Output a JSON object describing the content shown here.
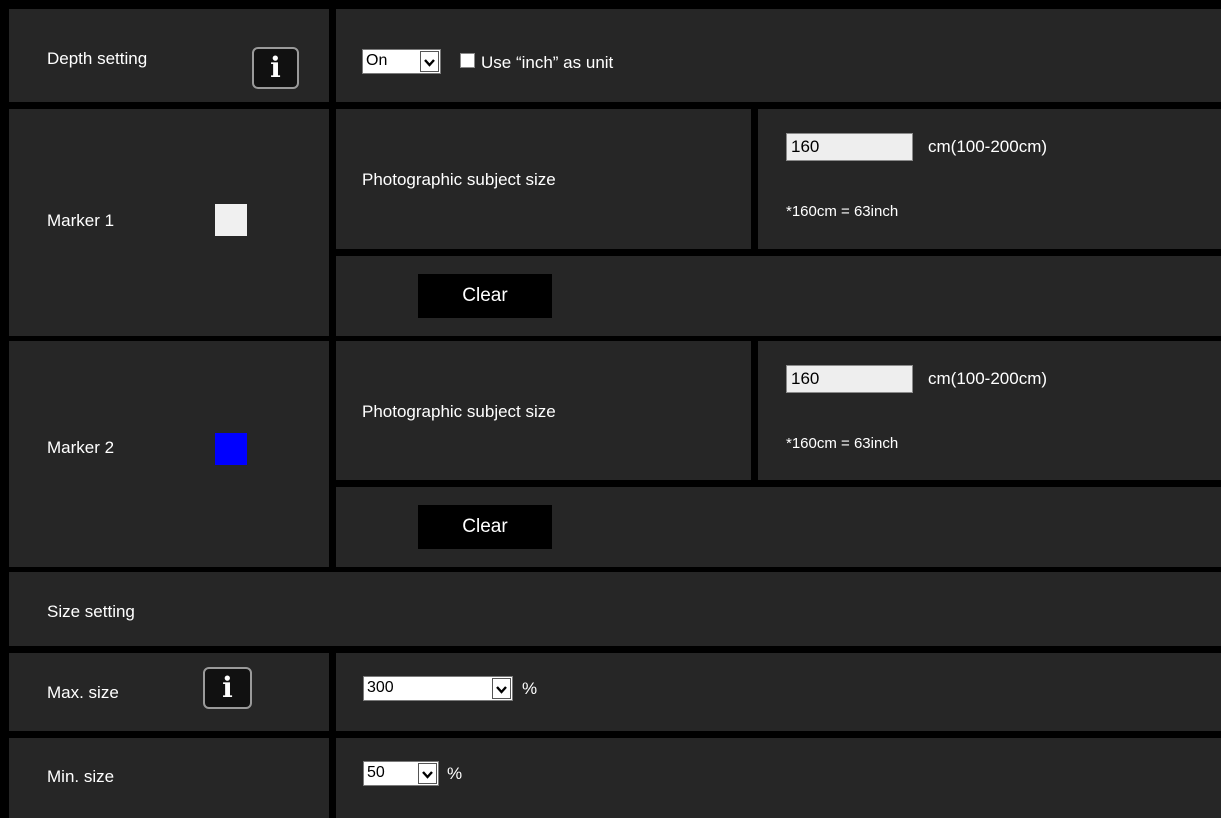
{
  "depth_setting": {
    "label": "Depth setting",
    "info_symbol": "i",
    "mode_value": "On",
    "inch_unit_label": "Use “inch” as unit",
    "inch_unit_checked": false
  },
  "markers": [
    {
      "label": "Marker 1",
      "color": "#f0f0f0",
      "subject_size_label": "Photographic subject size",
      "size_value": "160",
      "size_range": "cm(100-200cm)",
      "conversion_note": "*160cm = 63inch",
      "clear_label": "Clear"
    },
    {
      "label": "Marker 2",
      "color": "#0000ff",
      "subject_size_label": "Photographic subject size",
      "size_value": "160",
      "size_range": "cm(100-200cm)",
      "conversion_note": "*160cm = 63inch",
      "clear_label": "Clear"
    }
  ],
  "size_setting": {
    "header": "Size setting",
    "max_label": "Max. size",
    "max_info_symbol": "i",
    "max_value": "300",
    "max_unit": "%",
    "min_label": "Min. size",
    "min_value": "50",
    "min_unit": "%"
  },
  "icons": {
    "info": "info-icon",
    "dropdown": "chevron-down-icon"
  }
}
